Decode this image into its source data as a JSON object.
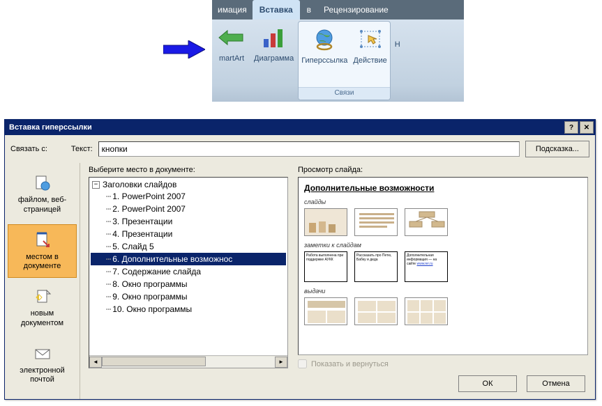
{
  "ribbon": {
    "tabs": [
      "имация",
      "Вставка",
      "в",
      "Рецензирование"
    ],
    "active_index": 1,
    "buttons": {
      "smartart": "martArt",
      "chart": "Диаграмма",
      "hyperlink": "Гиперссылка",
      "action": "Действие",
      "edge": "Н"
    },
    "group_links": "Связи"
  },
  "dialog": {
    "title": "Вставка гиперссылки",
    "link_with": "Связать с:",
    "text_label": "Текст:",
    "text_value": "кнопки",
    "hint_button": "Подсказка...",
    "sidebar": [
      {
        "id": "file",
        "label": "файлом, веб-\nстраницей"
      },
      {
        "id": "place",
        "label": "местом в\nдокументе"
      },
      {
        "id": "new",
        "label": "новым\nдокументом"
      },
      {
        "id": "email",
        "label": "электронной\nпочтой"
      }
    ],
    "sidebar_active": 1,
    "tree_label": "Выберите место в документе:",
    "tree_root": "Заголовки слайдов",
    "tree_items": [
      "1. PowerPoint 2007",
      "2. PowerPoint 2007",
      "3. Презентации",
      "4. Презентации",
      "5. Слайд 5",
      "6. Дополнительные возможнос",
      "7. Содержание слайда",
      "8. Окно программы",
      "9. Окно программы",
      "10. Окно программы"
    ],
    "tree_selected": 5,
    "preview_label": "Просмотр слайда:",
    "preview_title": "Дополнительные возможности",
    "preview_sub1": "слайды",
    "preview_sub2": "заметки к слайдам",
    "preview_sub3": "выдачи",
    "thumb_text1": "Работа выполнена при поддержке АУКК",
    "thumb_text2": "Рассказать про Петю, Бабку и деда",
    "thumb_text3": "Дополнительная информация — на сайте",
    "thumb_link": "www.ier.ru",
    "show_return": "Показать и вернуться",
    "ok": "ОК",
    "cancel": "Отмена"
  }
}
